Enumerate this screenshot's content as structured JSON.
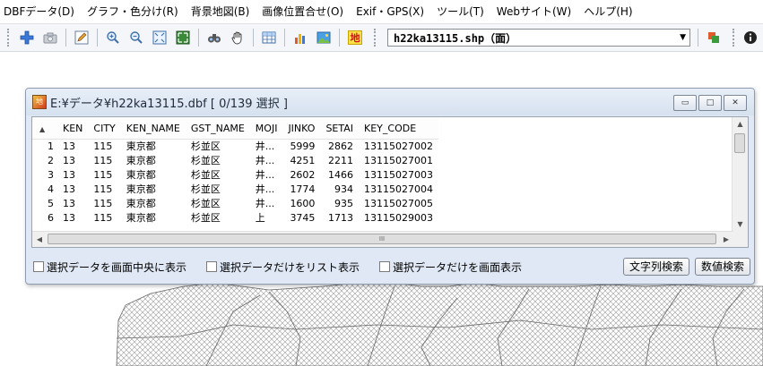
{
  "menu": [
    "DBFデータ(D)",
    "グラフ・色分け(R)",
    "背景地図(B)",
    "画像位置合せ(O)",
    "Exif・GPS(X)",
    "ツール(T)",
    "Webサイト(W)",
    "ヘルプ(H)"
  ],
  "toolbar": {
    "layer_select_value": "h22ka13115.shp（面）",
    "map_label_icon_text": "地"
  },
  "window": {
    "title": "E:¥データ¥h22ka13115.dbf  [ 0/139 選択 ]",
    "minimize": "▭",
    "maximize": "□",
    "close": "✕"
  },
  "table": {
    "columns": [
      "KEN",
      "CITY",
      "KEN_NAME",
      "GST_NAME",
      "MOJI",
      "JINKO",
      "SETAI",
      "KEY_CODE"
    ],
    "rows": [
      {
        "n": "1",
        "cells": [
          "13",
          "115",
          "東京都",
          "杉並区",
          "井...",
          "5999",
          "2862",
          "13115027002"
        ]
      },
      {
        "n": "2",
        "cells": [
          "13",
          "115",
          "東京都",
          "杉並区",
          "井...",
          "4251",
          "2211",
          "13115027001"
        ]
      },
      {
        "n": "3",
        "cells": [
          "13",
          "115",
          "東京都",
          "杉並区",
          "井...",
          "2602",
          "1466",
          "13115027003"
        ]
      },
      {
        "n": "4",
        "cells": [
          "13",
          "115",
          "東京都",
          "杉並区",
          "井...",
          "1774",
          "934",
          "13115027004"
        ]
      },
      {
        "n": "5",
        "cells": [
          "13",
          "115",
          "東京都",
          "杉並区",
          "井...",
          "1600",
          "935",
          "13115027005"
        ]
      },
      {
        "n": "6",
        "cells": [
          "13",
          "115",
          "東京都",
          "杉並区",
          "上",
          "3745",
          "1713",
          "13115029003"
        ]
      }
    ],
    "hscroll_grip": "III"
  },
  "controls": {
    "cb_center": "選択データを画面中央に表示",
    "cb_list": "選択データだけをリスト表示",
    "cb_screen": "選択データだけを画面表示",
    "btn_text_search": "文字列検索",
    "btn_num_search": "数値検索"
  },
  "colors": {
    "toolbar_bg": "#f4f6fa",
    "window_frame": "#dfe8f4",
    "map_hatch": "#9a9a9a"
  }
}
